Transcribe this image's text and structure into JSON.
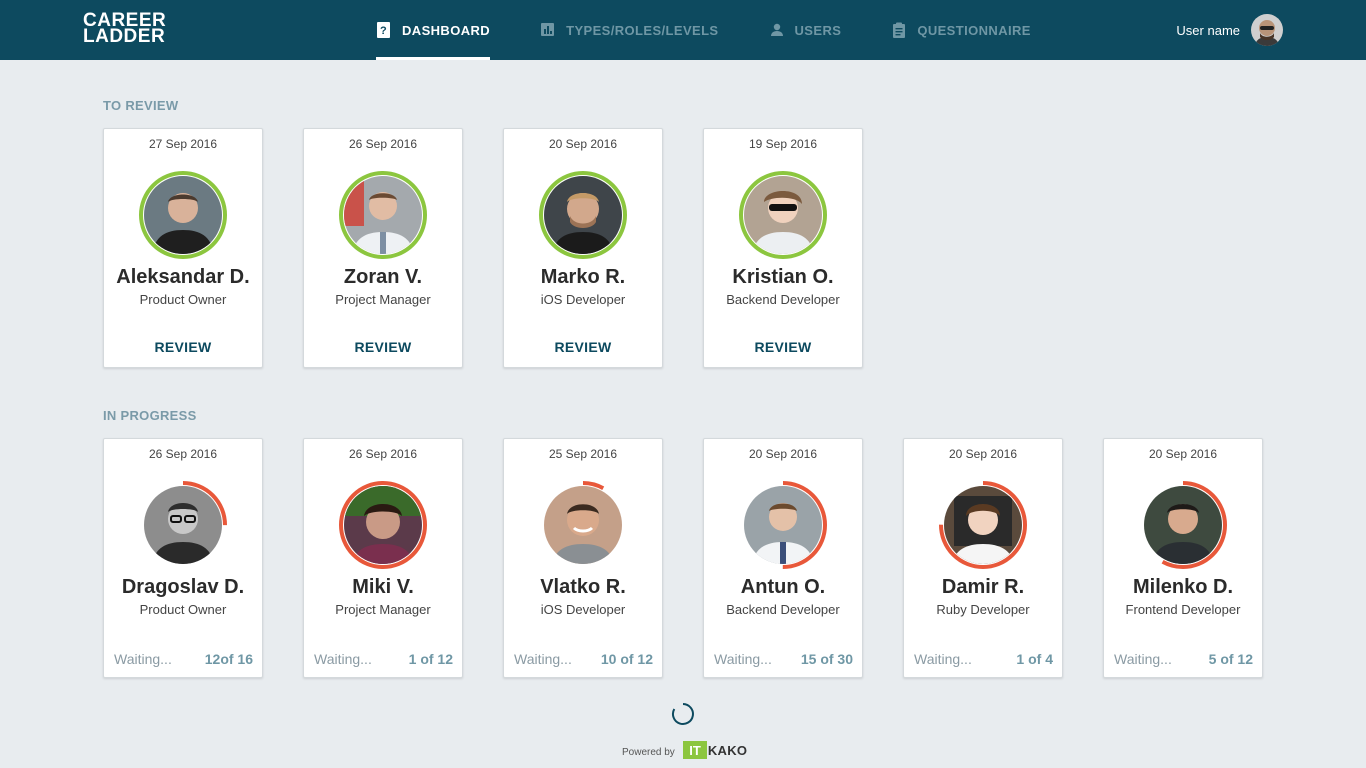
{
  "app": {
    "logo_line1": "CAREER",
    "logo_line2": "LADDER",
    "brand_color": "#0d4a5f",
    "review_ring_color": "#8cc63f",
    "progress_ring_color": "#e8583a"
  },
  "nav": {
    "items": [
      {
        "label": "DASHBOARD",
        "icon": "question-icon",
        "active": true
      },
      {
        "label": "TYPES/ROLES/LEVELS",
        "icon": "bar-chart-icon",
        "active": false
      },
      {
        "label": "USERS",
        "icon": "person-icon",
        "active": false
      },
      {
        "label": "QUESTIONNAIRE",
        "icon": "clipboard-icon",
        "active": false
      }
    ]
  },
  "user": {
    "name": "User name"
  },
  "to_review": {
    "title": "TO REVIEW",
    "action_label": "REVIEW",
    "cards": [
      {
        "date": "27 Sep 2016",
        "name": "Aleksandar D.",
        "role": "Product Owner",
        "photo_tone": "#6b7a82"
      },
      {
        "date": "26 Sep 2016",
        "name": "Zoran V.",
        "role": "Project Manager",
        "photo_tone": "#a4a9ad"
      },
      {
        "date": "20 Sep 2016",
        "name": "Marko R.",
        "role": "iOS Developer",
        "photo_tone": "#3f454a"
      },
      {
        "date": "19 Sep 2016",
        "name": "Kristian O.",
        "role": "Backend Developer",
        "photo_tone": "#b2a393"
      }
    ]
  },
  "in_progress": {
    "title": "IN PROGRESS",
    "cards": [
      {
        "date": "26 Sep 2016",
        "name": "Dragoslav D.",
        "role": "Product Owner",
        "status": "Waiting...",
        "progress": "12of 16",
        "fraction": 0.25,
        "photo_tone": "#8d8d8d"
      },
      {
        "date": "26 Sep 2016",
        "name": "Miki V.",
        "role": "Project Manager",
        "status": "Waiting...",
        "progress": "1 of 12",
        "fraction": 1.0,
        "photo_tone": "#5b3a4a"
      },
      {
        "date": "25 Sep 2016",
        "name": "Vlatko R.",
        "role": "iOS Developer",
        "status": "Waiting...",
        "progress": "10 of 12",
        "fraction": 0.08,
        "photo_tone": "#c4a089"
      },
      {
        "date": "20 Sep 2016",
        "name": "Antun O.",
        "role": "Backend Developer",
        "status": "Waiting...",
        "progress": "15 of 30",
        "fraction": 0.5,
        "photo_tone": "#9aa3a8"
      },
      {
        "date": "20 Sep 2016",
        "name": "Damir R.",
        "role": "Ruby Developer",
        "status": "Waiting...",
        "progress": "1 of 4",
        "fraction": 0.75,
        "photo_tone": "#5a4a3c"
      },
      {
        "date": "20 Sep 2016",
        "name": "Milenko D.",
        "role": "Frontend Developer",
        "status": "Waiting...",
        "progress": "5 of 12",
        "fraction": 0.58,
        "photo_tone": "#3e4a3f"
      }
    ]
  },
  "footer": {
    "powered_by": "Powered by",
    "brand": "KAKO",
    "brand_mark": "IT"
  }
}
